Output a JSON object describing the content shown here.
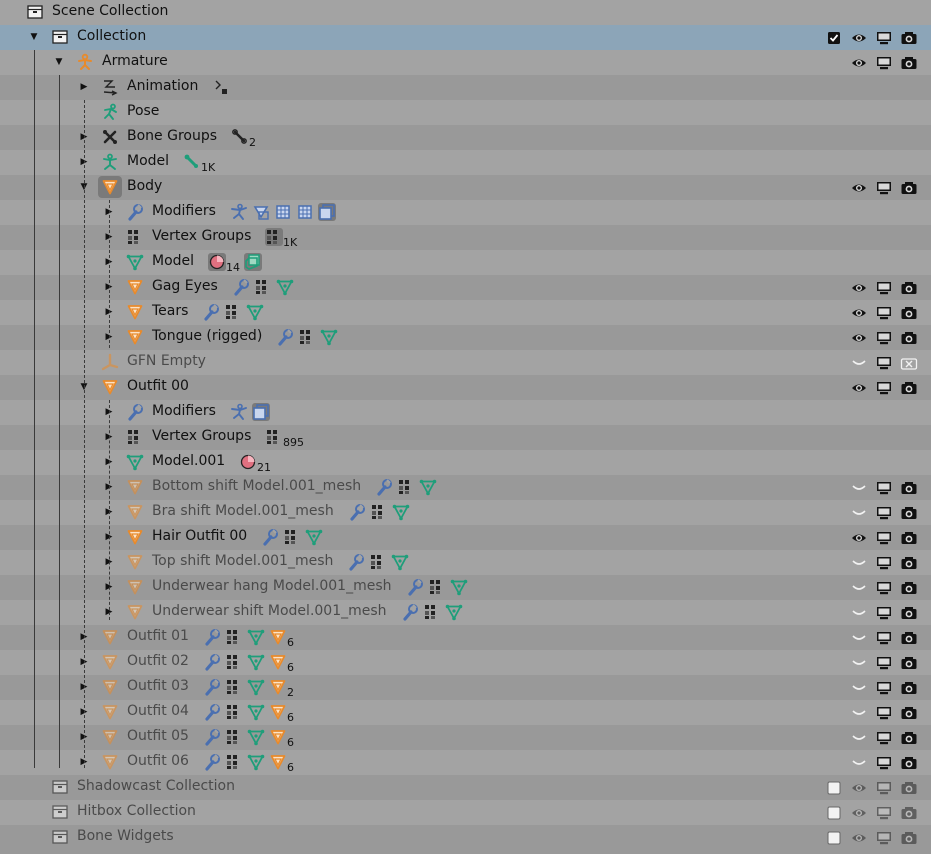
{
  "outliner": {
    "rows": [
      {
        "label": "Scene Collection",
        "depth": 0,
        "icon": "collection-box-icon",
        "expand": "none",
        "toggles": "none",
        "extras": []
      },
      {
        "label": "Collection",
        "depth": 1,
        "icon": "collection-box-icon",
        "expand": "open",
        "toggles": "full-check",
        "selected": true,
        "extras": []
      },
      {
        "label": "Armature",
        "depth": 2,
        "icon": "armature-icon",
        "expand": "open",
        "toggles": "full",
        "extras": []
      },
      {
        "label": "Animation",
        "depth": 3,
        "icon": "animation-icon",
        "expand": "closed",
        "toggles": "none",
        "extras": [
          {
            "icon": "action-icon",
            "count": ""
          }
        ]
      },
      {
        "label": "Pose",
        "depth": 3,
        "icon": "pose-icon",
        "expand": "none",
        "toggles": "none",
        "extras": []
      },
      {
        "label": "Bone Groups",
        "depth": 3,
        "icon": "bone-groups-icon",
        "expand": "closed",
        "toggles": "none",
        "extras": [
          {
            "icon": "bone-group-icon",
            "count": "2"
          }
        ]
      },
      {
        "label": "Model",
        "depth": 3,
        "icon": "armature-data-icon",
        "expand": "closed",
        "toggles": "none",
        "extras": [
          {
            "icon": "bone-icon",
            "count": "1K"
          }
        ]
      },
      {
        "label": "Body",
        "depth": 3,
        "icon": "mesh-object-icon",
        "expand": "open",
        "toggles": "full",
        "boxed": true,
        "extras": []
      },
      {
        "label": "Modifiers",
        "depth": 4,
        "icon": "wrench-icon",
        "expand": "closed",
        "toggles": "none",
        "extras": [
          {
            "icon": "armature-modifier-icon",
            "count": ""
          },
          {
            "icon": "shrinkwrap-modifier-icon",
            "count": ""
          },
          {
            "icon": "subsurf-modifier-icon",
            "count": ""
          },
          {
            "icon": "subsurf-modifier-icon",
            "count": ""
          },
          {
            "icon": "solidify-modifier-icon",
            "count": "",
            "boxed": true
          }
        ]
      },
      {
        "label": "Vertex Groups",
        "depth": 4,
        "icon": "vertex-groups-icon",
        "expand": "closed",
        "toggles": "none",
        "extras": [
          {
            "icon": "vertex-groups-icon",
            "count": "1K",
            "boxed": true
          }
        ]
      },
      {
        "label": "Model",
        "depth": 4,
        "icon": "mesh-data-icon",
        "expand": "closed",
        "toggles": "none",
        "extras": [
          {
            "icon": "material-icon",
            "count": "14",
            "boxed": true
          },
          {
            "icon": "shape-keys-icon",
            "count": "",
            "boxed": true
          }
        ]
      },
      {
        "label": "Gag Eyes",
        "depth": 4,
        "icon": "mesh-object-icon",
        "expand": "closed",
        "toggles": "full",
        "extras": [
          {
            "icon": "wrench-icon",
            "count": ""
          },
          {
            "icon": "vertex-groups-icon",
            "count": ""
          },
          {
            "icon": "mesh-data-icon",
            "count": ""
          }
        ]
      },
      {
        "label": "Tears",
        "depth": 4,
        "icon": "mesh-object-icon",
        "expand": "closed",
        "toggles": "full",
        "extras": [
          {
            "icon": "wrench-icon",
            "count": ""
          },
          {
            "icon": "vertex-groups-icon",
            "count": ""
          },
          {
            "icon": "mesh-data-icon",
            "count": ""
          }
        ]
      },
      {
        "label": "Tongue (rigged)",
        "depth": 4,
        "icon": "mesh-object-icon",
        "expand": "closed",
        "toggles": "full",
        "extras": [
          {
            "icon": "wrench-icon",
            "count": ""
          },
          {
            "icon": "vertex-groups-icon",
            "count": ""
          },
          {
            "icon": "mesh-data-icon",
            "count": ""
          }
        ]
      },
      {
        "label": "GFN Empty",
        "depth": 3,
        "icon": "empty-icon",
        "expand": "none",
        "toggles": "hidden-norender",
        "dim": true,
        "extras": []
      },
      {
        "label": "Outfit 00",
        "depth": 3,
        "icon": "mesh-object-icon",
        "expand": "open",
        "toggles": "full",
        "extras": []
      },
      {
        "label": "Modifiers",
        "depth": 4,
        "icon": "wrench-icon",
        "expand": "closed",
        "toggles": "none",
        "extras": [
          {
            "icon": "armature-modifier-icon",
            "count": ""
          },
          {
            "icon": "solidify-modifier-icon",
            "count": "",
            "boxed": true
          }
        ]
      },
      {
        "label": "Vertex Groups",
        "depth": 4,
        "icon": "vertex-groups-icon",
        "expand": "closed",
        "toggles": "none",
        "extras": [
          {
            "icon": "vertex-groups-icon",
            "count": "895"
          }
        ]
      },
      {
        "label": "Model.001",
        "depth": 4,
        "icon": "mesh-data-icon",
        "expand": "closed",
        "toggles": "none",
        "extras": [
          {
            "icon": "material-icon",
            "count": "21"
          }
        ]
      },
      {
        "label": "Bottom shift Model.001_mesh",
        "depth": 4,
        "icon": "mesh-object-icon",
        "expand": "closed",
        "toggles": "hidden",
        "dim": true,
        "extras": [
          {
            "icon": "wrench-icon",
            "count": ""
          },
          {
            "icon": "vertex-groups-icon",
            "count": ""
          },
          {
            "icon": "mesh-data-icon",
            "count": ""
          }
        ]
      },
      {
        "label": "Bra shift Model.001_mesh",
        "depth": 4,
        "icon": "mesh-object-icon",
        "expand": "closed",
        "toggles": "hidden",
        "dim": true,
        "extras": [
          {
            "icon": "wrench-icon",
            "count": ""
          },
          {
            "icon": "vertex-groups-icon",
            "count": ""
          },
          {
            "icon": "mesh-data-icon",
            "count": ""
          }
        ]
      },
      {
        "label": "Hair Outfit 00",
        "depth": 4,
        "icon": "mesh-object-icon",
        "expand": "closed",
        "toggles": "full",
        "extras": [
          {
            "icon": "wrench-icon",
            "count": ""
          },
          {
            "icon": "vertex-groups-icon",
            "count": ""
          },
          {
            "icon": "mesh-data-icon",
            "count": ""
          }
        ]
      },
      {
        "label": "Top shift Model.001_mesh",
        "depth": 4,
        "icon": "mesh-object-icon",
        "expand": "closed",
        "toggles": "hidden",
        "dim": true,
        "extras": [
          {
            "icon": "wrench-icon",
            "count": ""
          },
          {
            "icon": "vertex-groups-icon",
            "count": ""
          },
          {
            "icon": "mesh-data-icon",
            "count": ""
          }
        ]
      },
      {
        "label": "Underwear hang Model.001_mesh",
        "depth": 4,
        "icon": "mesh-object-icon",
        "expand": "closed",
        "toggles": "hidden",
        "dim": true,
        "extras": [
          {
            "icon": "wrench-icon",
            "count": ""
          },
          {
            "icon": "vertex-groups-icon",
            "count": ""
          },
          {
            "icon": "mesh-data-icon",
            "count": ""
          }
        ]
      },
      {
        "label": "Underwear shift Model.001_mesh",
        "depth": 4,
        "icon": "mesh-object-icon",
        "expand": "closed",
        "toggles": "hidden",
        "dim": true,
        "extras": [
          {
            "icon": "wrench-icon",
            "count": ""
          },
          {
            "icon": "vertex-groups-icon",
            "count": ""
          },
          {
            "icon": "mesh-data-icon",
            "count": ""
          }
        ]
      },
      {
        "label": "Outfit 01",
        "depth": 3,
        "icon": "mesh-object-icon",
        "expand": "closed",
        "toggles": "hidden",
        "dim": true,
        "extras": [
          {
            "icon": "wrench-icon",
            "count": ""
          },
          {
            "icon": "vertex-groups-icon",
            "count": ""
          },
          {
            "icon": "mesh-data-icon",
            "count": ""
          },
          {
            "icon": "mesh-object-icon",
            "count": "6"
          }
        ]
      },
      {
        "label": "Outfit 02",
        "depth": 3,
        "icon": "mesh-object-icon",
        "expand": "closed",
        "toggles": "hidden",
        "dim": true,
        "extras": [
          {
            "icon": "wrench-icon",
            "count": ""
          },
          {
            "icon": "vertex-groups-icon",
            "count": ""
          },
          {
            "icon": "mesh-data-icon",
            "count": ""
          },
          {
            "icon": "mesh-object-icon",
            "count": "6"
          }
        ]
      },
      {
        "label": "Outfit 03",
        "depth": 3,
        "icon": "mesh-object-icon",
        "expand": "closed",
        "toggles": "hidden",
        "dim": true,
        "extras": [
          {
            "icon": "wrench-icon",
            "count": ""
          },
          {
            "icon": "vertex-groups-icon",
            "count": ""
          },
          {
            "icon": "mesh-data-icon",
            "count": ""
          },
          {
            "icon": "mesh-object-icon",
            "count": "2"
          }
        ]
      },
      {
        "label": "Outfit 04",
        "depth": 3,
        "icon": "mesh-object-icon",
        "expand": "closed",
        "toggles": "hidden",
        "dim": true,
        "extras": [
          {
            "icon": "wrench-icon",
            "count": ""
          },
          {
            "icon": "vertex-groups-icon",
            "count": ""
          },
          {
            "icon": "mesh-data-icon",
            "count": ""
          },
          {
            "icon": "mesh-object-icon",
            "count": "6"
          }
        ]
      },
      {
        "label": "Outfit 05",
        "depth": 3,
        "icon": "mesh-object-icon",
        "expand": "closed",
        "toggles": "hidden",
        "dim": true,
        "extras": [
          {
            "icon": "wrench-icon",
            "count": ""
          },
          {
            "icon": "vertex-groups-icon",
            "count": ""
          },
          {
            "icon": "mesh-data-icon",
            "count": ""
          },
          {
            "icon": "mesh-object-icon",
            "count": "6"
          }
        ]
      },
      {
        "label": "Outfit 06",
        "depth": 3,
        "icon": "mesh-object-icon",
        "expand": "closed",
        "toggles": "hidden",
        "dim": true,
        "extras": [
          {
            "icon": "wrench-icon",
            "count": ""
          },
          {
            "icon": "vertex-groups-icon",
            "count": ""
          },
          {
            "icon": "mesh-data-icon",
            "count": ""
          },
          {
            "icon": "mesh-object-icon",
            "count": "6"
          }
        ]
      },
      {
        "label": "Shadowcast Collection",
        "depth": 1,
        "icon": "collection-box-icon",
        "expand": "none",
        "toggles": "excluded",
        "dim": true,
        "extras": []
      },
      {
        "label": "Hitbox Collection",
        "depth": 1,
        "icon": "collection-box-icon",
        "expand": "none",
        "toggles": "excluded",
        "dim": true,
        "extras": []
      },
      {
        "label": "Bone Widgets",
        "depth": 1,
        "icon": "collection-box-icon",
        "expand": "none",
        "toggles": "excluded",
        "dim": true,
        "extras": []
      }
    ]
  },
  "colors": {
    "row_even": "#a3a3a3",
    "row_odd": "#999999",
    "row_selected": "#8ca5b8",
    "object_orange": "#e88a2b",
    "data_green": "#1e9e7a",
    "modifier_blue": "#4a6fb0"
  }
}
